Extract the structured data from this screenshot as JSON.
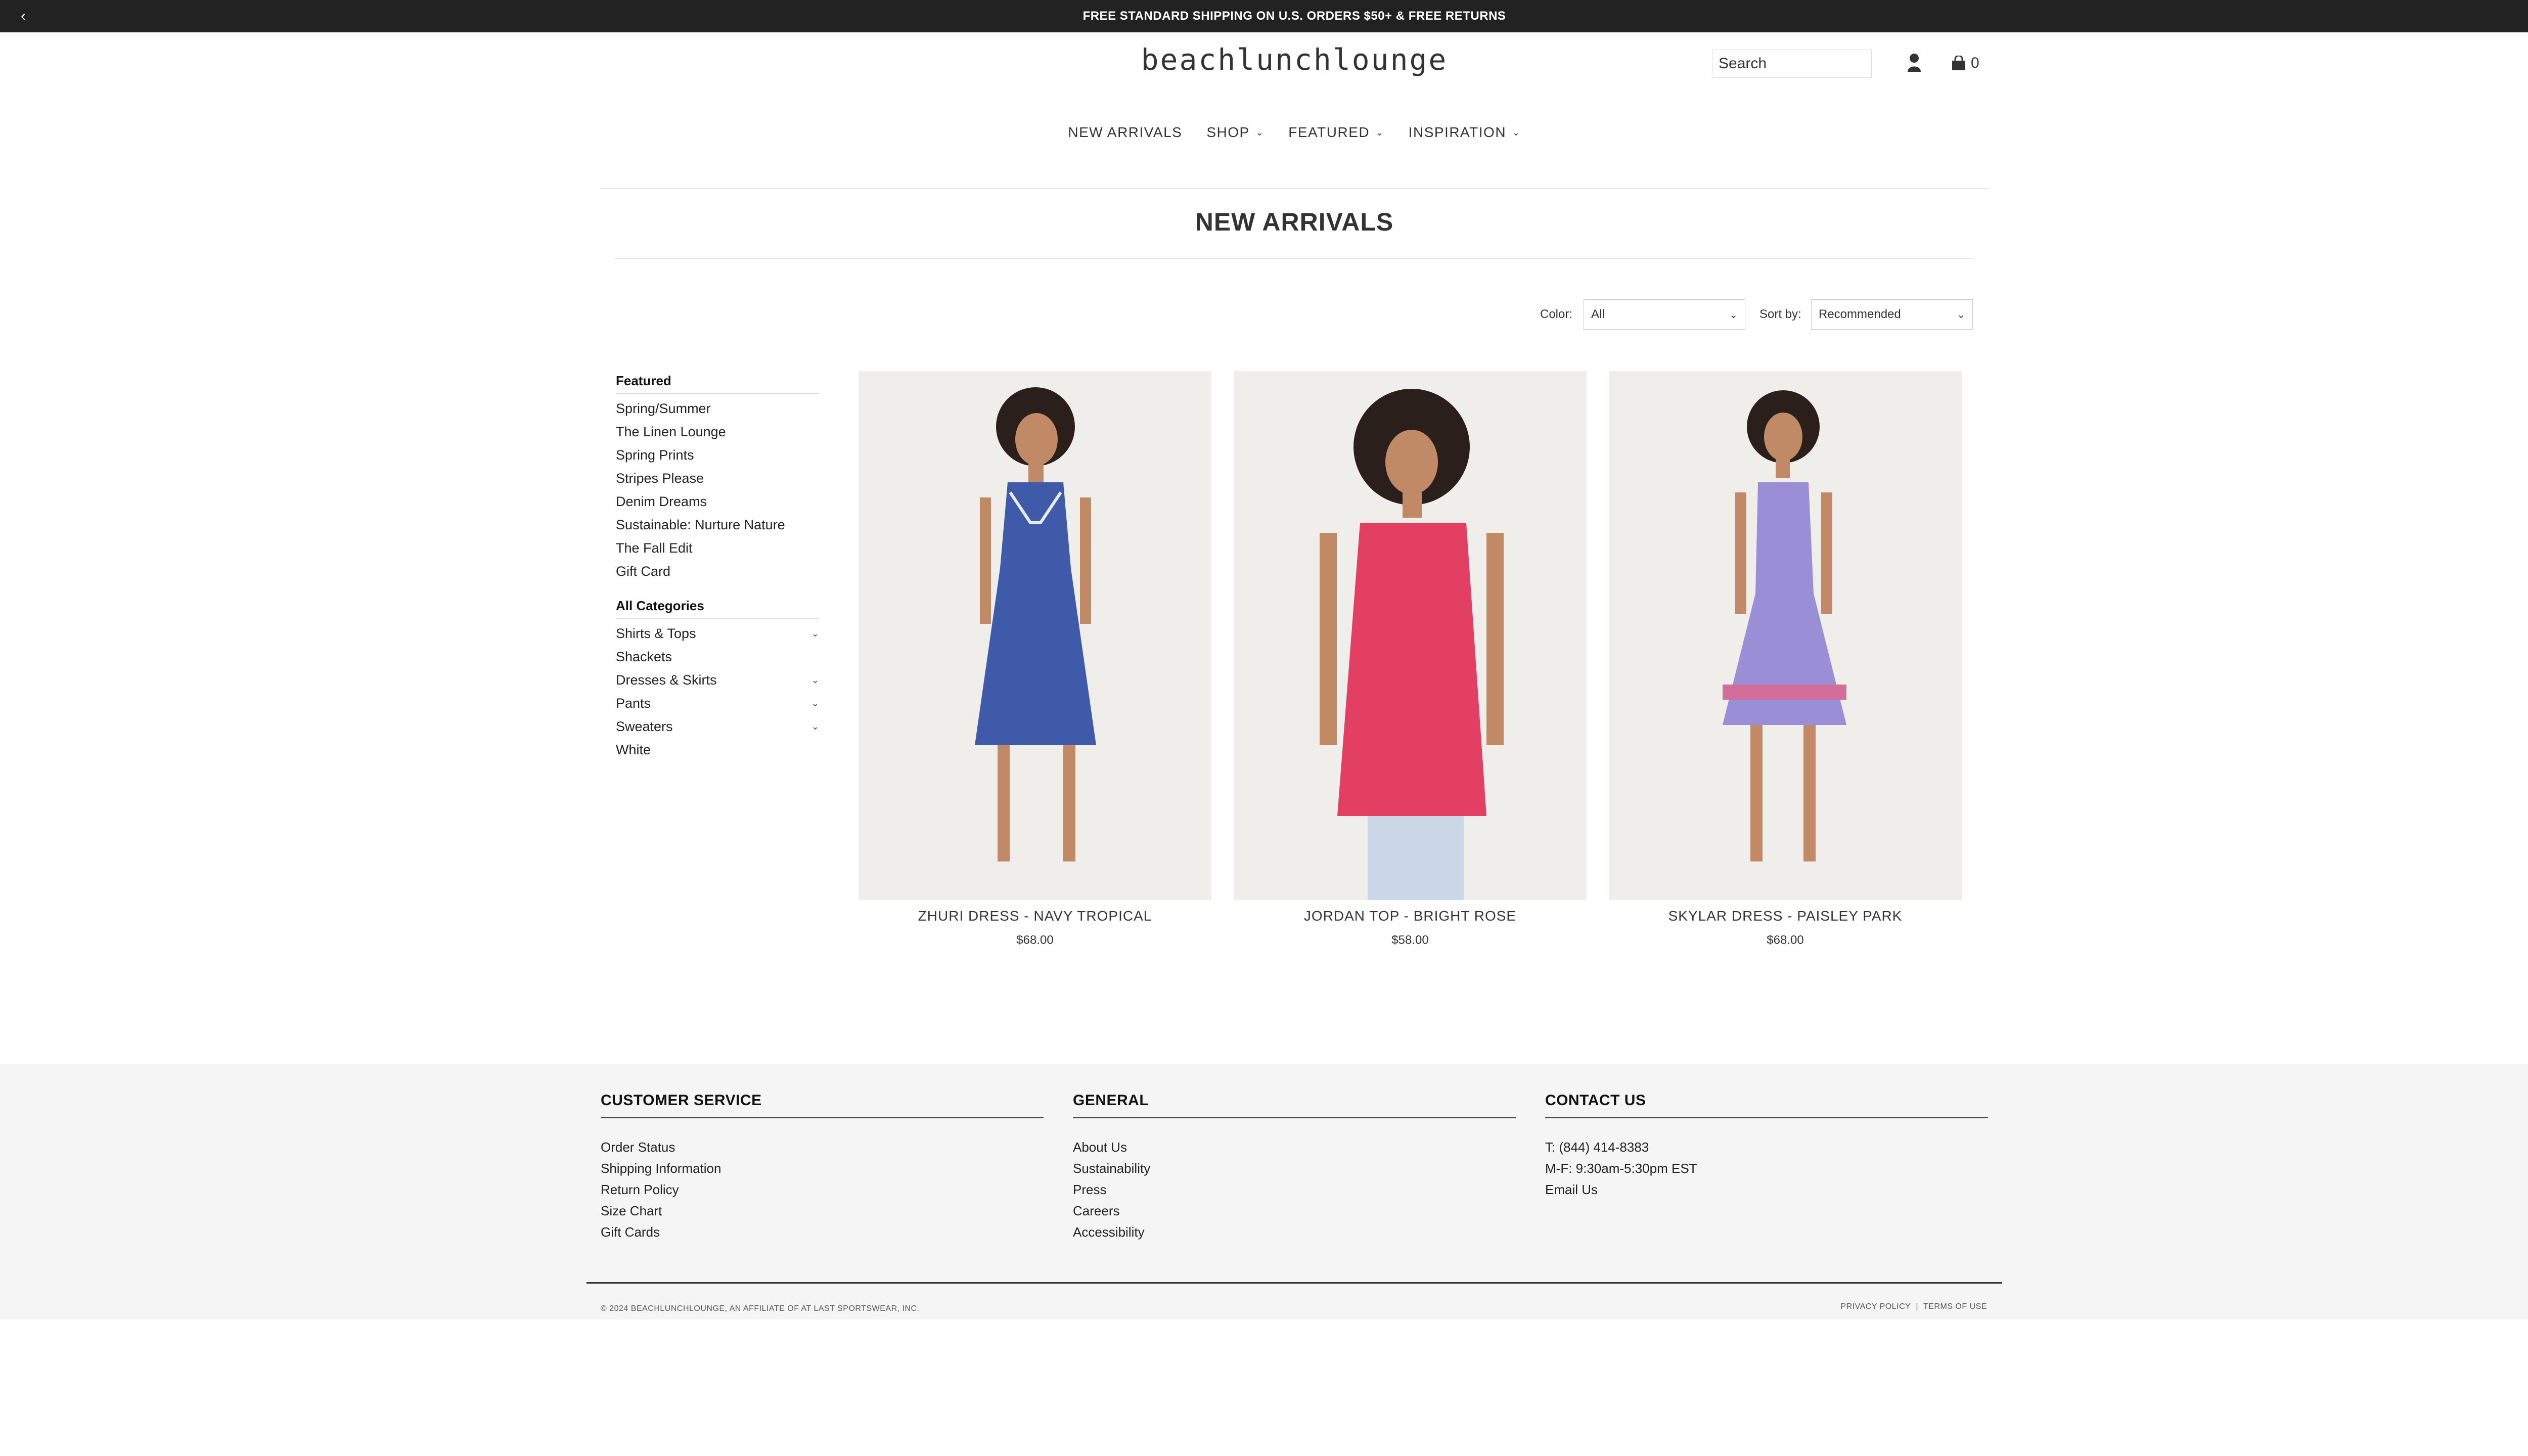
{
  "announcement": {
    "text": "FREE STANDARD SHIPPING ON U.S. ORDERS $50+ & FREE RETURNS",
    "prev_icon": "chevron-left-icon",
    "next_icon": "chevron-right-icon"
  },
  "header": {
    "logo": "beachlunchlounge",
    "search_placeholder": "Search",
    "cart_count": "0"
  },
  "nav": {
    "items": [
      {
        "label": "NEW ARRIVALS",
        "has_menu": false
      },
      {
        "label": "SHOP",
        "has_menu": true
      },
      {
        "label": "FEATURED",
        "has_menu": true
      },
      {
        "label": "INSPIRATION",
        "has_menu": true
      }
    ]
  },
  "page": {
    "title": "NEW ARRIVALS"
  },
  "filters": {
    "color_label": "Color:",
    "color_value": "All",
    "sort_label": "Sort by:",
    "sort_value": "Recommended"
  },
  "sidebar": {
    "featured_heading": "Featured",
    "featured_items": [
      "Spring/Summer",
      "The Linen Lounge",
      "Spring Prints",
      "Stripes Please",
      "Denim Dreams",
      "Sustainable: Nurture Nature",
      "The Fall Edit",
      "Gift Card"
    ],
    "categories_heading": "All Categories",
    "category_items": [
      {
        "label": "Shirts & Tops",
        "expandable": true
      },
      {
        "label": "Shackets",
        "expandable": false
      },
      {
        "label": "Dresses & Skirts",
        "expandable": true
      },
      {
        "label": "Pants",
        "expandable": true
      },
      {
        "label": "Sweaters",
        "expandable": true
      },
      {
        "label": "White",
        "expandable": false
      }
    ]
  },
  "products": [
    {
      "name": "ZHURI DRESS - NAVY TROPICAL",
      "price": "$68.00",
      "garment_color": "#3f5aa8"
    },
    {
      "name": "JORDAN TOP - BRIGHT ROSE",
      "price": "$58.00",
      "garment_color": "#e33f62"
    },
    {
      "name": "SKYLAR DRESS - PAISLEY PARK",
      "price": "$68.00",
      "garment_color": "#9a8fd6"
    }
  ],
  "footer": {
    "columns": [
      {
        "heading": "CUSTOMER SERVICE",
        "links": [
          "Order Status",
          "Shipping Information",
          "Return Policy",
          "Size Chart",
          "Gift Cards"
        ]
      },
      {
        "heading": "GENERAL",
        "links": [
          "About Us",
          "Sustainability",
          "Press",
          "Careers",
          "Accessibility"
        ]
      },
      {
        "heading": "CONTACT US",
        "links": [
          "T: (844) 414-8383",
          "M-F: 9:30am-5:30pm EST",
          "Email Us"
        ]
      }
    ],
    "copyright": "© 2024 BEACHLUNCHLOUNGE, AN AFFILIATE OF AT LAST SPORTSWEAR, INC.",
    "privacy": "PRIVACY POLICY",
    "separator": "|",
    "terms": "TERMS OF USE"
  },
  "accessibility_widget_icon": "accessibility-icon"
}
